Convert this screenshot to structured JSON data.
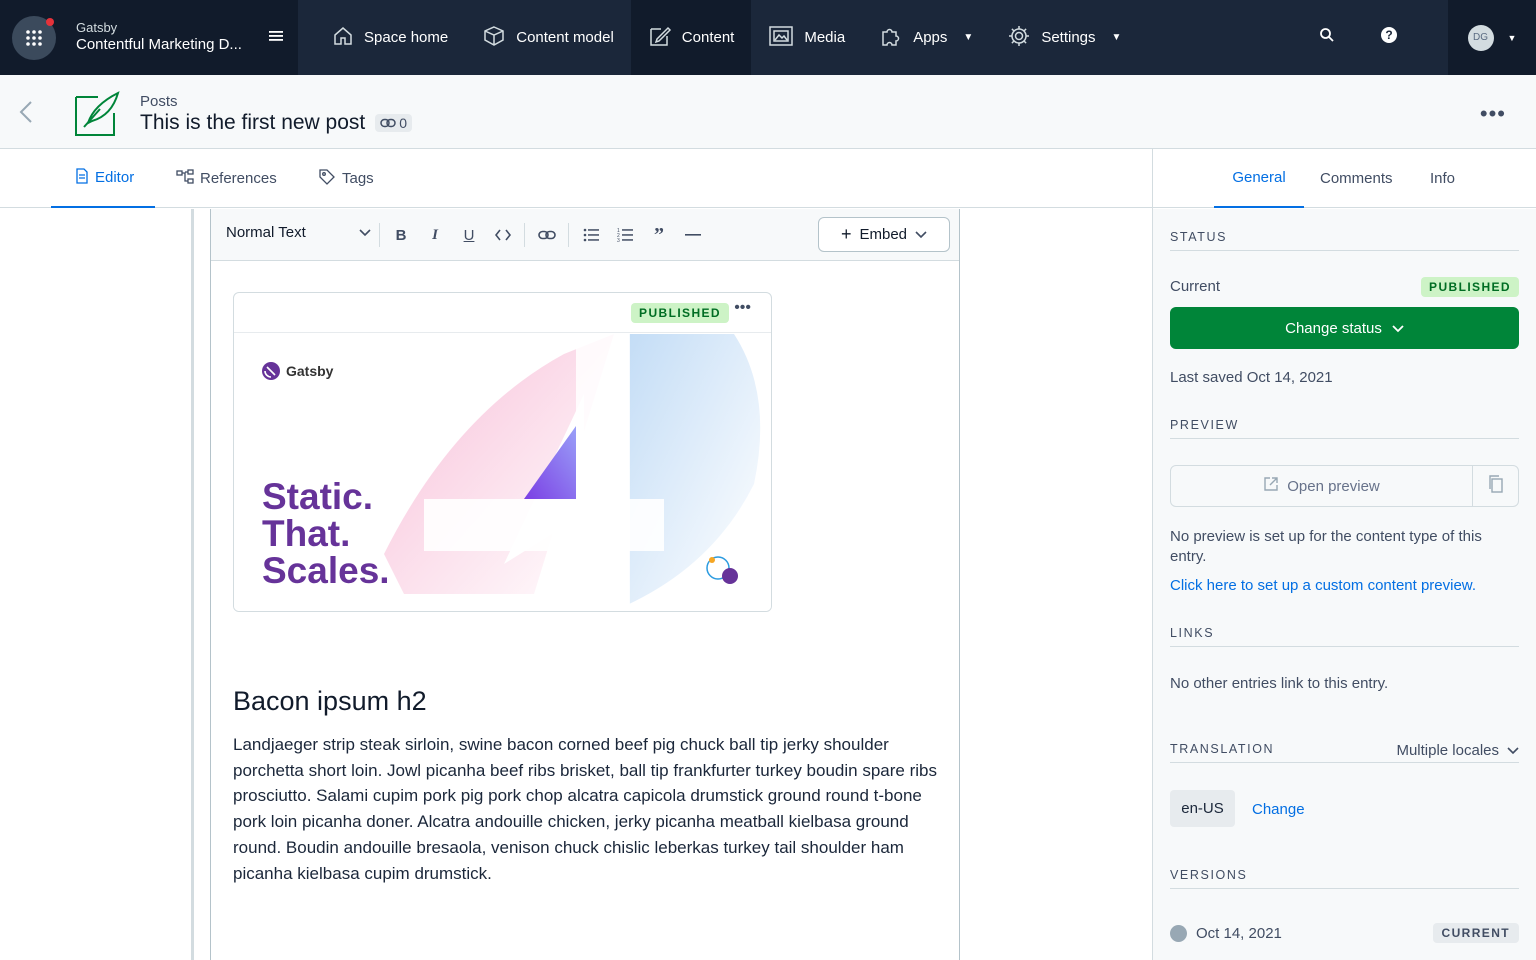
{
  "colors": {
    "nav_bg": "#1b273a",
    "nav_active_bg": "#111b2b",
    "primary_blue": "#036fe3",
    "positive_green": "#008539",
    "published_badge_bg": "#cdf3c6",
    "published_badge_fg": "#006d23"
  },
  "topnav": {
    "org_name": "Gatsby",
    "space_name": "Contentful Marketing D...",
    "items": [
      {
        "label": "Space home",
        "icon": "home-icon"
      },
      {
        "label": "Content model",
        "icon": "cube-icon"
      },
      {
        "label": "Content",
        "icon": "pencil-square-icon",
        "active": true
      },
      {
        "label": "Media",
        "icon": "image-icon"
      },
      {
        "label": "Apps",
        "icon": "puzzle-icon",
        "dropdown": true
      },
      {
        "label": "Settings",
        "icon": "gear-icon",
        "dropdown": true
      }
    ],
    "avatar_initials": "DG"
  },
  "entry": {
    "content_type": "Posts",
    "title": "This is the first new post",
    "link_count": "0"
  },
  "tabs": {
    "left": [
      {
        "label": "Editor",
        "icon": "document-icon",
        "active": true
      },
      {
        "label": "References",
        "icon": "hierarchy-icon"
      },
      {
        "label": "Tags",
        "icon": "tag-icon"
      }
    ],
    "right": [
      {
        "label": "General",
        "active": true
      },
      {
        "label": "Comments"
      },
      {
        "label": "Info"
      }
    ]
  },
  "toolbar": {
    "text_style": "Normal Text",
    "embed_label": "Embed"
  },
  "embedded_entry": {
    "status": "PUBLISHED",
    "image": {
      "brand": "Gatsby",
      "headline_lines": [
        "Static.",
        "That.",
        "Scales."
      ],
      "big_number": "4"
    }
  },
  "document": {
    "heading": "Bacon ipsum h2",
    "paragraph": "Landjaeger strip steak sirloin, swine bacon corned beef pig chuck ball tip jerky shoulder porchetta short loin. Jowl picanha beef ribs brisket, ball tip frankfurter turkey boudin spare ribs prosciutto. Salami cupim pork pig pork chop alcatra capicola drumstick ground round t-bone pork loin picanha doner. Alcatra andouille chicken, jerky picanha meatball kielbasa ground round. Boudin andouille bresaola, venison chuck chislic leberkas turkey tail shoulder ham picanha kielbasa cupim drumstick."
  },
  "sidebar": {
    "status": {
      "title": "STATUS",
      "current_label": "Current",
      "current_value": "PUBLISHED",
      "change_button": "Change status",
      "last_saved": "Last saved Oct 14, 2021"
    },
    "preview": {
      "title": "PREVIEW",
      "open_button": "Open preview",
      "note": "No preview is set up for the content type of this entry.",
      "setup_link": "Click here to set up a custom content preview."
    },
    "links": {
      "title": "LINKS",
      "note": "No other entries link to this entry."
    },
    "translation": {
      "title": "TRANSLATION",
      "mode": "Multiple locales",
      "locale": "en-US",
      "change_link": "Change"
    },
    "versions": {
      "title": "VERSIONS",
      "items": [
        {
          "date": "Oct 14, 2021",
          "badge": "CURRENT"
        }
      ]
    }
  }
}
